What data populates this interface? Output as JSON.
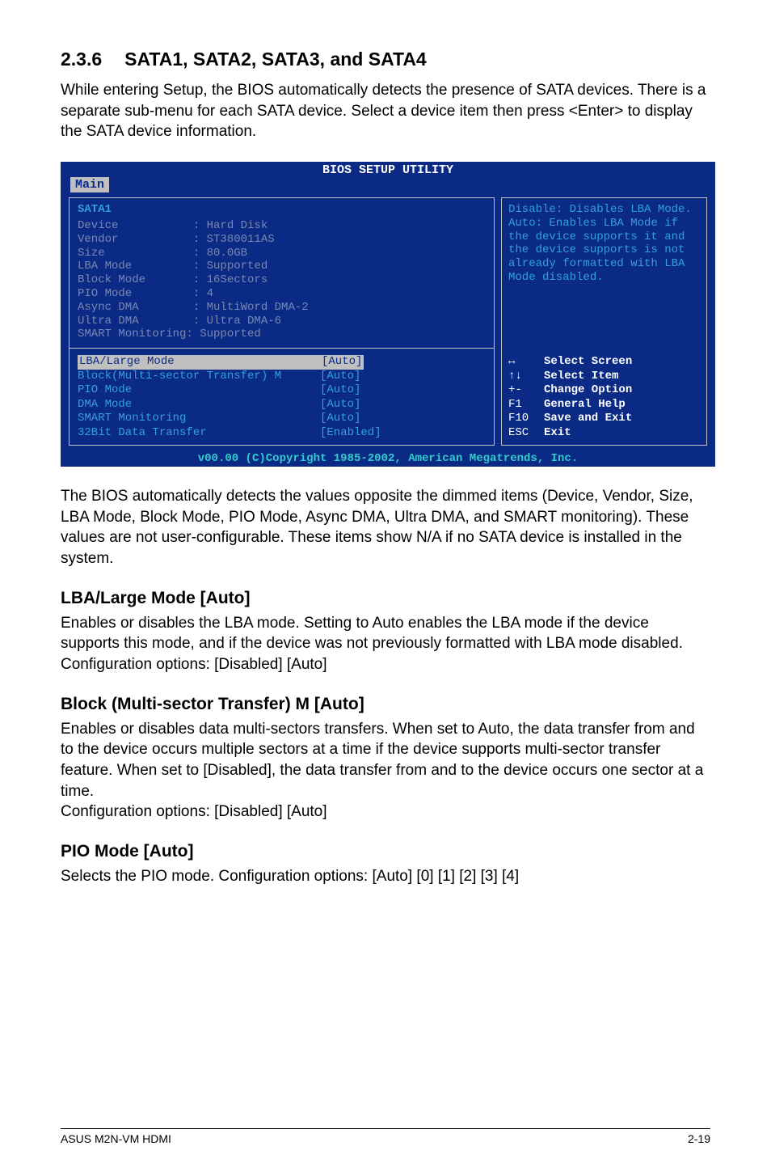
{
  "section": {
    "number": "2.3.6",
    "title": "SATA1, SATA2, SATA3, and SATA4",
    "intro": "While entering Setup, the BIOS automatically detects the presence of SATA devices. There is a separate sub-menu for each SATA device. Select a device item then press <Enter> to display the SATA device information."
  },
  "bios": {
    "top_title": "BIOS SETUP UTILITY",
    "tab": "Main",
    "sata_heading": "SATA1",
    "dimmed": {
      "device": "Device           : Hard Disk",
      "vendor": "Vendor           : ST380011AS",
      "size": "Size             : 80.0GB",
      "lba": "LBA Mode         : Supported",
      "block": "Block Mode       : 16Sectors",
      "pio": "PIO Mode         : 4",
      "async": "Async DMA        : MultiWord DMA-2",
      "ultra": "Ultra DMA        : Ultra DMA-6",
      "smart": "SMART Monitoring: Supported"
    },
    "selected": {
      "label": "LBA/Large Mode",
      "value": "[Auto]"
    },
    "options": [
      {
        "label": "Block(Multi-sector Transfer) M",
        "value": "[Auto]"
      },
      {
        "label": "PIO Mode",
        "value": "[Auto]"
      },
      {
        "label": "DMA Mode",
        "value": "[Auto]"
      },
      {
        "label": "SMART Monitoring",
        "value": "[Auto]"
      },
      {
        "label": "32Bit Data Transfer",
        "value": "[Enabled]"
      }
    ],
    "help": "Disable: Disables LBA Mode.\nAuto: Enables LBA Mode if the device supports it and the device supports is not already formatted with LBA Mode disabled.",
    "keys": [
      {
        "k": "↔",
        "d": "Select Screen"
      },
      {
        "k": "↑↓",
        "d": "Select Item"
      },
      {
        "k": "+-",
        "d": "Change Option"
      },
      {
        "k": "F1",
        "d": "General Help"
      },
      {
        "k": "F10",
        "d": "Save and Exit"
      },
      {
        "k": "ESC",
        "d": "Exit"
      }
    ],
    "footer": "v00.00 (C)Copyright 1985-2002, American Megatrends, Inc."
  },
  "para_after_bios": "The BIOS automatically detects the values opposite the dimmed items (Device, Vendor, Size, LBA Mode, Block Mode, PIO Mode, Async DMA, Ultra DMA, and SMART monitoring). These values are not user-configurable. These items show N/A if no SATA device is installed in the system.",
  "subsections": {
    "lba": {
      "title": "LBA/Large Mode [Auto]",
      "body": "Enables or disables the LBA mode. Setting to Auto enables the LBA mode if the device supports this mode, and if the device was not previously formatted with LBA mode disabled. Configuration options: [Disabled] [Auto]"
    },
    "block": {
      "title": "Block (Multi-sector Transfer) M [Auto]",
      "body": "Enables or disables data multi-sectors transfers. When set to Auto, the data transfer from and to the device occurs multiple sectors at a time if the device supports multi-sector transfer feature. When set to [Disabled], the data transfer from and to the device occurs one sector at a time.\nConfiguration options: [Disabled] [Auto]"
    },
    "pio": {
      "title": "PIO Mode [Auto]",
      "body": "Selects the PIO mode. Configuration options: [Auto] [0] [1] [2] [3] [4]"
    }
  },
  "footer": {
    "left": "ASUS M2N-VM HDMI",
    "right": "2-19"
  }
}
